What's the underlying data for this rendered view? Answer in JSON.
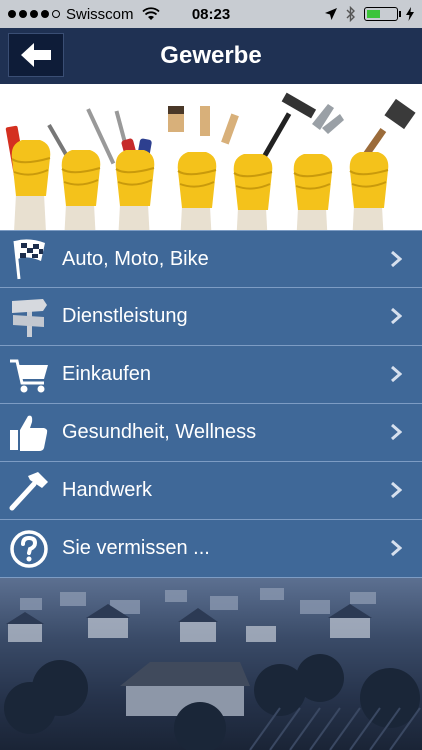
{
  "status_bar": {
    "carrier": "Swisscom",
    "time": "08:23",
    "signal_bars": 4,
    "battery_level": 0.45,
    "battery_color": "#3cc43a"
  },
  "nav": {
    "title": "Gewerbe",
    "back_icon": "arrow-left-icon"
  },
  "banner": {
    "description_icon": "tools-banner-image"
  },
  "menu": {
    "items": [
      {
        "label": "Auto, Moto, Bike",
        "icon": "checkered-flag-icon"
      },
      {
        "label": "Dienstleistung",
        "icon": "signpost-icon"
      },
      {
        "label": "Einkaufen",
        "icon": "shopping-cart-icon"
      },
      {
        "label": "Gesundheit, Wellness",
        "icon": "thumbs-up-icon"
      },
      {
        "label": "Handwerk",
        "icon": "hammer-icon"
      },
      {
        "label": "Sie vermissen ...",
        "icon": "question-icon"
      }
    ]
  },
  "colors": {
    "nav_background": "#1f3153",
    "menu_background": "#3f6898",
    "menu_divider": "#7d9cc4"
  }
}
